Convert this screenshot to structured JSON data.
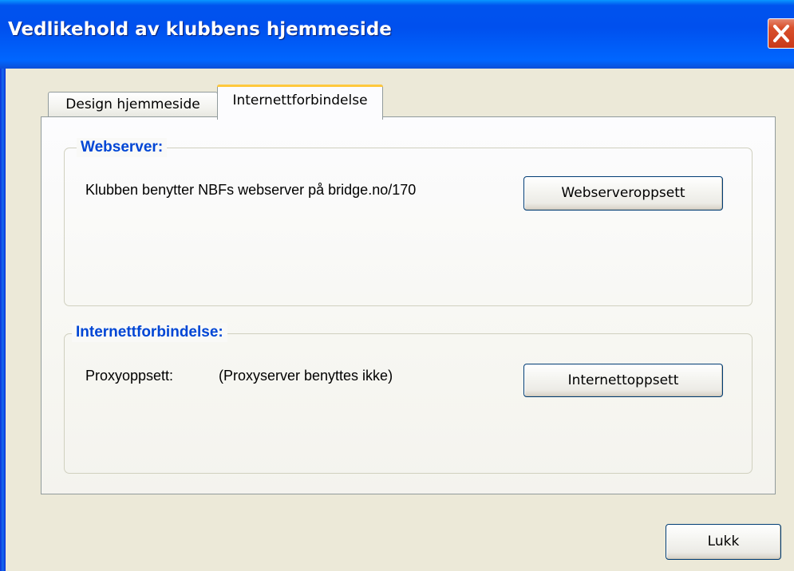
{
  "window": {
    "title": "Vedlikehold av klubbens hjemmeside",
    "close_icon": "close-icon"
  },
  "tabs": [
    {
      "label": "Design hjemmeside",
      "selected": false
    },
    {
      "label": "Internettforbindelse",
      "selected": true
    }
  ],
  "webserver_group": {
    "legend": "Webserver:",
    "info_text": "Klubben benytter NBFs webserver på bridge.no/170",
    "button_label": "Webserveroppsett"
  },
  "internet_group": {
    "legend": "Internettforbindelse:",
    "proxy_label": "Proxyoppsett:",
    "proxy_value": "(Proxyserver benyttes ikke)",
    "button_label": "Internettoppsett"
  },
  "footer": {
    "close_label": "Lukk"
  },
  "colors": {
    "titlebar": "#0053ee",
    "group_legend": "#0046d5",
    "tab_highlight": "#ffc83c",
    "close_button": "#d9502c",
    "dialog_background": "#ece9d8"
  }
}
